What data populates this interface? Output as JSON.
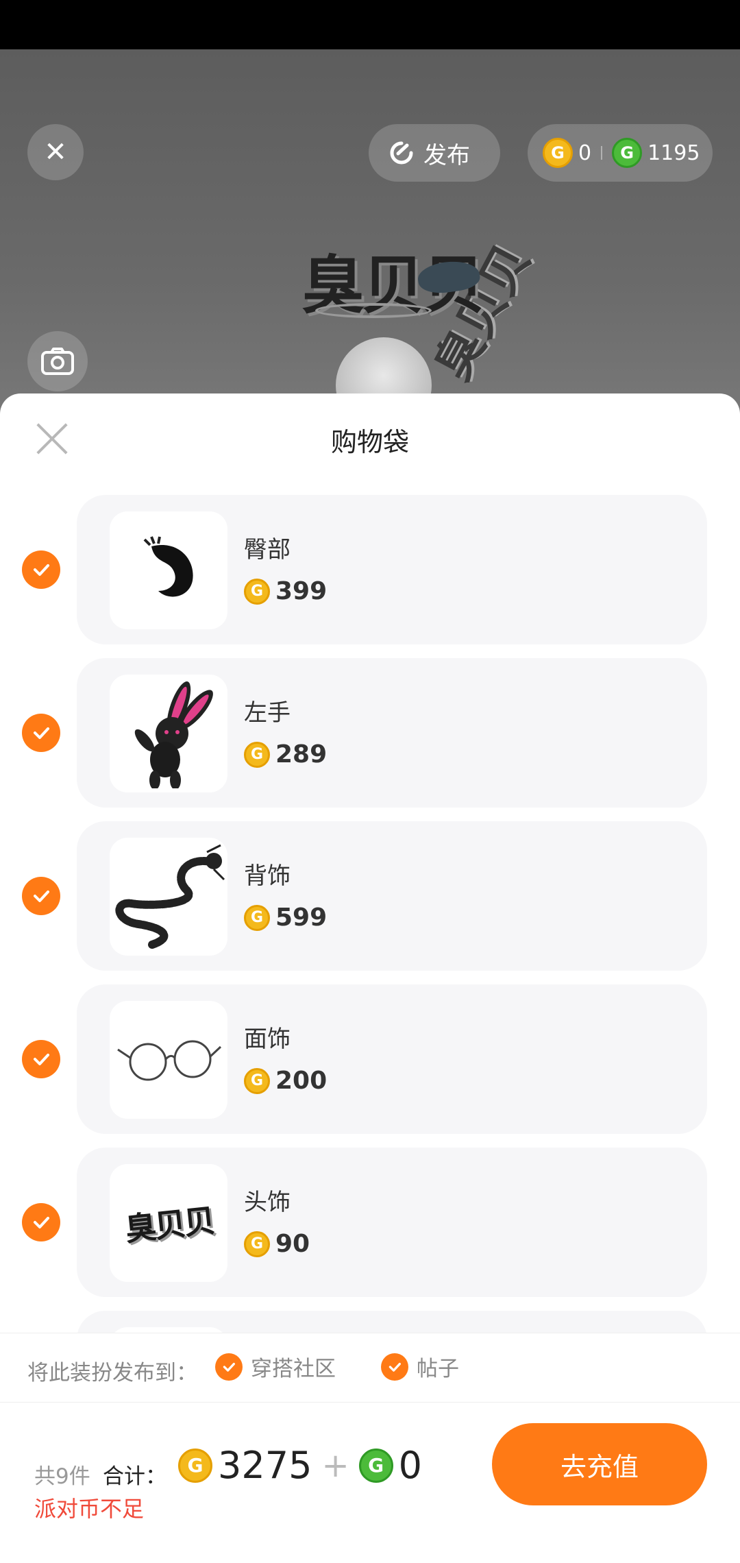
{
  "top": {
    "publish_label": "发布",
    "gold_balance": "0",
    "green_balance": "1195",
    "scene_text": "臭贝贝"
  },
  "sheet": {
    "title": "购物袋"
  },
  "items": [
    {
      "name": "臀部",
      "price": "399"
    },
    {
      "name": "左手",
      "price": "289"
    },
    {
      "name": "背饰",
      "price": "599"
    },
    {
      "name": "面饰",
      "price": "200"
    },
    {
      "name": "头饰",
      "price": "90"
    }
  ],
  "publish": {
    "label": "将此装扮发布到：",
    "options": [
      {
        "label": "穿搭社区",
        "checked": true
      },
      {
        "label": "帖子",
        "checked": true
      }
    ]
  },
  "summary": {
    "count": "共9件",
    "total_label": "合计：",
    "gold_total": "3275",
    "plus": "+",
    "green_total": "0",
    "warning": "派对币不足",
    "button": "去充值"
  },
  "colors": {
    "accent": "#ff7a15",
    "gold_coin": "#f4b91c",
    "green_coin": "#4cbb3a",
    "warning": "#f04a3a"
  }
}
